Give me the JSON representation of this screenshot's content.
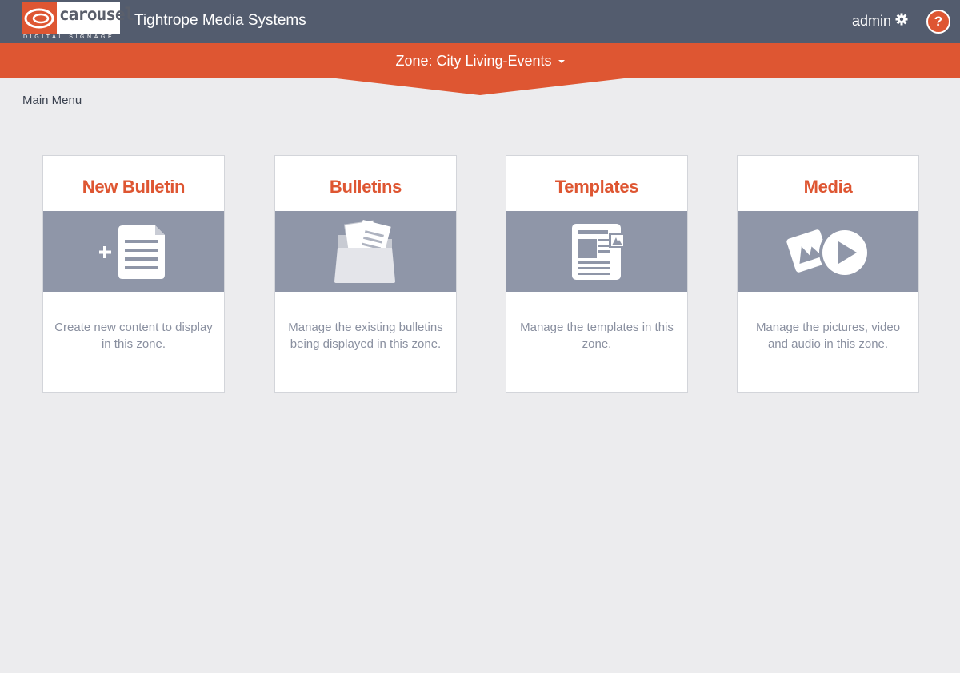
{
  "header": {
    "logo_word": "carousel",
    "logo_tagline": "DIGITAL SIGNAGE",
    "org_name": "Tightrope Media Systems",
    "user_label": "admin",
    "help_label": "?"
  },
  "zone": {
    "label": "Zone: City Living-Events"
  },
  "breadcrumb": "Main Menu",
  "cards": [
    {
      "title": "New Bulletin",
      "description": "Create new content to display in this zone.",
      "icon": "new-bulletin-icon"
    },
    {
      "title": "Bulletins",
      "description": "Manage the existing bulletins being displayed in this zone.",
      "icon": "folder-icon"
    },
    {
      "title": "Templates",
      "description": "Manage the templates in this zone.",
      "icon": "template-icon"
    },
    {
      "title": "Media",
      "description": "Manage the pictures, video and audio in this zone.",
      "icon": "media-icon"
    }
  ],
  "colors": {
    "topbar": "#535c6e",
    "accent": "#de5632",
    "card_band": "#8f96a8",
    "background": "#ececee"
  }
}
